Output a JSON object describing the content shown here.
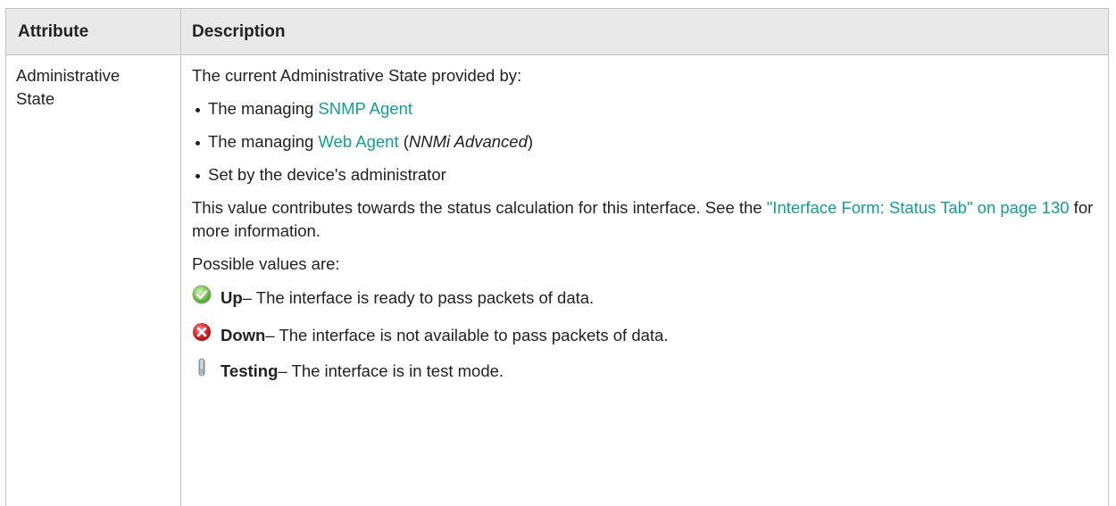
{
  "table": {
    "headers": [
      "Attribute",
      "Description"
    ],
    "attribute": [
      "Administrative",
      "State"
    ],
    "intro": "The current Administrative State provided by:",
    "bullets": [
      {
        "prefix": "The managing ",
        "link": "SNMP Agent",
        "suffix_open": "",
        "italic": "",
        "suffix_close": ""
      },
      {
        "prefix": "The managing ",
        "link": "Web Agent",
        "suffix_open": " (",
        "italic": "NNMi Advanced",
        "suffix_close": ")"
      },
      {
        "prefix": "Set by the device's administrator",
        "link": "",
        "suffix_open": "",
        "italic": "",
        "suffix_close": ""
      }
    ],
    "contribution": {
      "before": "This value contributes towards the status calculation for this interface. See the ",
      "link": "\"Interface Form: Status Tab\" on page 130",
      "after": " for more information."
    },
    "possible_values_label": "Possible values are:",
    "values": [
      {
        "icon": "green-check-icon",
        "name": "Up",
        "text": " – The interface is ready to pass packets of data."
      },
      {
        "icon": "red-x-icon",
        "name": "Down",
        "text": " – The interface is not available to pass packets of data."
      },
      {
        "icon": "test-tube-icon",
        "name": "Testing",
        "text": " – The interface is in test mode."
      }
    ]
  },
  "colors": {
    "link": "#0fa38a",
    "header_bg": "#e9e9e9",
    "border": "#c4c4c4",
    "up": "#6cc24a",
    "down": "#d9262e"
  }
}
